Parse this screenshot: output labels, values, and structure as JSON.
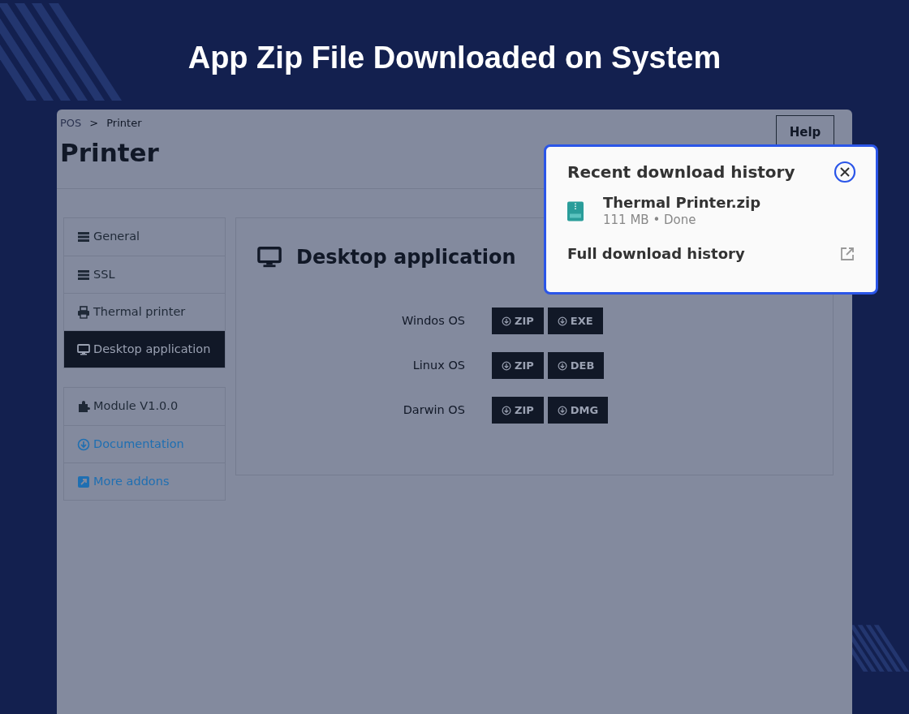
{
  "headline": "App Zip File Downloaded on System",
  "breadcrumb": [
    "POS",
    ">",
    "Printer"
  ],
  "page_title": "Printer",
  "help_button": "Help",
  "sidebar": {
    "groups": [
      [
        {
          "label": "General",
          "kind": "server",
          "selected": false
        },
        {
          "label": "SSL",
          "kind": "server",
          "selected": false
        },
        {
          "label": "Thermal printer",
          "kind": "printer",
          "selected": false
        },
        {
          "label": "Desktop application",
          "kind": "monitor",
          "selected": true
        }
      ],
      [
        {
          "label": "Module V1.0.0",
          "kind": "puzzle",
          "selected": false
        },
        {
          "label": "Documentation",
          "kind": "download",
          "selected": false
        },
        {
          "label": "More addons",
          "kind": "external",
          "selected": false
        }
      ]
    ]
  },
  "panel": {
    "title": "Desktop application",
    "rows": [
      {
        "label": "Windos OS",
        "buttons": [
          "ZIP",
          "EXE"
        ]
      },
      {
        "label": "Linux OS",
        "buttons": [
          "ZIP",
          "DEB"
        ]
      },
      {
        "label": "Darwin OS",
        "buttons": [
          "ZIP",
          "DMG"
        ]
      }
    ]
  },
  "download_popup": {
    "title": "Recent download history",
    "item": {
      "name": "Thermal Printer.zip",
      "meta": "111 MB • Done"
    },
    "footer_link": "Full download history"
  }
}
